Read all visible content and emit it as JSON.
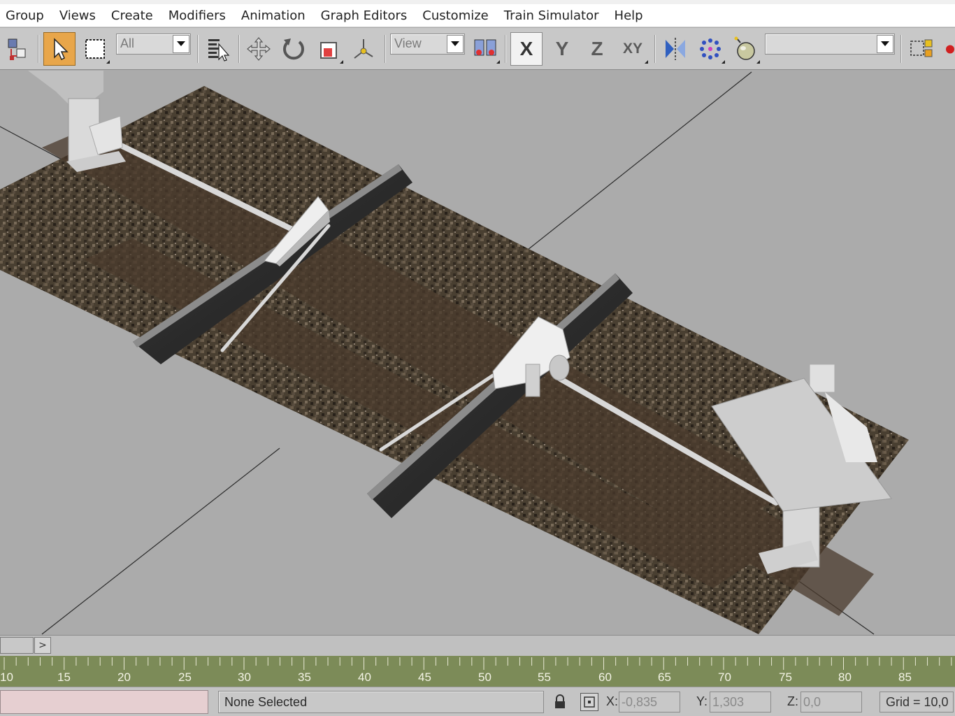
{
  "menu": {
    "items": [
      "Group",
      "Views",
      "Create",
      "Modifiers",
      "Animation",
      "Graph Editors",
      "Customize",
      "Train Simulator",
      "Help"
    ]
  },
  "toolbar": {
    "selection_filter": "All",
    "reference_coord": "View",
    "axis_x": "X",
    "axis_y": "Y",
    "axis_z": "Z",
    "axis_xy": "XY",
    "named_selection": ""
  },
  "timeline": {
    "next_label": ">",
    "ticks": [
      "10",
      "15",
      "20",
      "25",
      "30",
      "35",
      "40",
      "45",
      "50",
      "55",
      "60",
      "65",
      "70",
      "75",
      "80",
      "85"
    ]
  },
  "status": {
    "prompt": "None Selected",
    "x_label": "X:",
    "x_value": "-0,835",
    "y_label": "Y:",
    "y_value": "1,303",
    "z_label": "Z:",
    "z_value": "0,0",
    "grid": "Grid = 10,0"
  },
  "colors": {
    "viewport_bg": "#ababab",
    "toolbar_bg": "#c8c8c8",
    "active_tool": "#e8a64a",
    "timeline_green": "#7c8b58",
    "status_pink": "#e6cfd1",
    "ballast": "#544838",
    "sleeper": "#4a3a2c",
    "rail": "#3a3a3a",
    "mechanism": "#e8e8e8"
  },
  "icons": [
    "select-link-icon",
    "select-arrow-icon",
    "rect-select-icon",
    "select-by-name-icon",
    "move-icon",
    "rotate-icon",
    "scale-icon",
    "pivot-icon",
    "constraint-icon",
    "mirror-icon",
    "array-icon",
    "bomb-icon",
    "named-selection-icon"
  ]
}
